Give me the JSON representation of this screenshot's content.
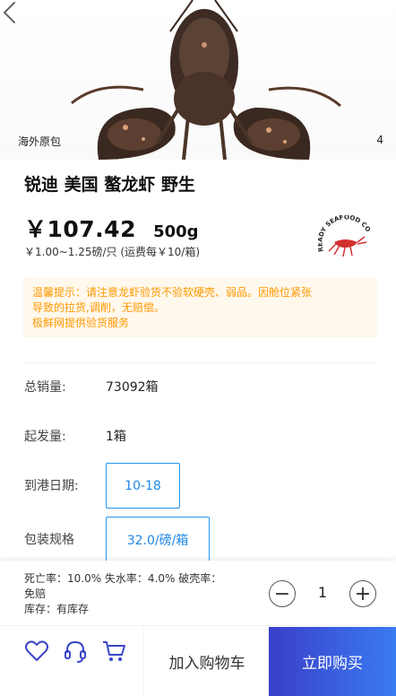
{
  "hero": {
    "origin_label": "海外原包",
    "pager": "4"
  },
  "product": {
    "title": "锐迪 美国 螯龙虾 野生",
    "price": "￥107.42",
    "weight": "500g",
    "price_note": "￥1.00~1.25磅/只 (运费每￥10/箱)",
    "brand_logo_text": "READY SEAFOOD CO"
  },
  "notice": {
    "line1": "温馨提示：请注意龙虾验货不验软硬壳、弱品。因舱位紧张",
    "line2": "导致的拉货,调削，无赔偿。",
    "line3": "极鲜网提供验货服务"
  },
  "details": {
    "sales_label": "总销量:",
    "sales_value": "73092箱",
    "min_order_label": "起发量:",
    "min_order_value": "1箱",
    "arrival_label": "到港日期:",
    "arrival_option": "10-18",
    "spec_label": "包装规格",
    "spec_option": "32.0/磅/箱"
  },
  "stats": {
    "line1": "死亡率：10.0%   失水率：4.0%   破壳率：",
    "line2": "免赔",
    "line3": "库存：有库存"
  },
  "stepper": {
    "minus": "−",
    "quantity": "1",
    "plus": "+"
  },
  "actions": {
    "add_to_cart": "加入购物车",
    "buy_now": "立即购买",
    "icons": [
      "heart-icon",
      "headset-icon",
      "cart-icon"
    ]
  },
  "colors": {
    "accent_blue": "#2196f3",
    "notice_text": "#ff9800",
    "notice_bg": "#fff8ec",
    "buy_gradient_start": "#3a3fc9",
    "buy_gradient_end": "#3a7bf2"
  }
}
